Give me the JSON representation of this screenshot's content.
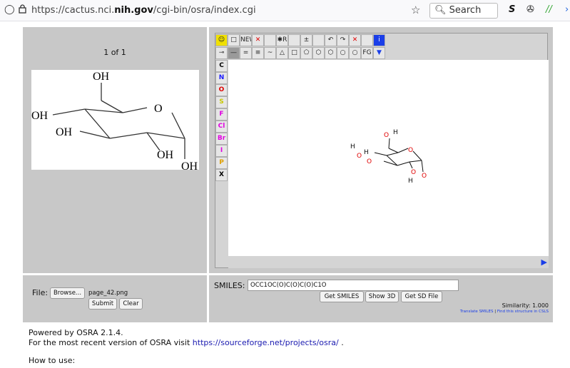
{
  "browser": {
    "url_prefix": "https://cactus.nci.",
    "url_domain": "nih.gov",
    "url_suffix": "/cgi-bin/osra/index.cgi",
    "search_placeholder": "Search"
  },
  "image_panel": {
    "page_indicator": "1 of 1"
  },
  "structure_labels": {
    "oh_top": "OH",
    "oh_left": "OH",
    "o_ring": "O",
    "oh_mid": "OH",
    "oh_bottom_a": "OH",
    "oh_bottom_b": "OH"
  },
  "editor": {
    "top_row": [
      "☺",
      "□",
      "NEW",
      "✕",
      "",
      "✱R",
      "",
      "±",
      "",
      "↶",
      "↷",
      "✕",
      "",
      "i"
    ],
    "second_row": [
      "⊸",
      "—",
      "=",
      "≡",
      "~",
      "△",
      "□",
      "⬠",
      "⬡",
      "⬡",
      "○",
      "○",
      "FG",
      "▼"
    ],
    "atoms": [
      "C",
      "N",
      "O",
      "S",
      "F",
      "Cl",
      "Br",
      "I",
      "P",
      "X"
    ],
    "atom_colors": [
      "#000000",
      "#1a1aff",
      "#e00000",
      "#c8c800",
      "#e000e0",
      "#e000e0",
      "#e000e0",
      "#e000e0",
      "#e0a000",
      "#000000"
    ],
    "canvas_labels": {
      "o1": "O",
      "h1": "H",
      "h2": "H",
      "o2": "O",
      "h3": "H",
      "o3": "O",
      "o4": "O",
      "o5": "O",
      "o6": "O",
      "h4": "H"
    }
  },
  "file_panel": {
    "label": "File:",
    "browse_label": "Browse...",
    "filename": "page_42.png",
    "submit_label": "Submit",
    "clear_label": "Clear"
  },
  "smiles_panel": {
    "label": "SMILES:",
    "value": "OCC1OC(O)C(O)C(O)C1O",
    "get_smiles_label": "Get SMILES",
    "show3d_label": "Show 3D",
    "get_sd_label": "Get SD File",
    "similarity": "Similarity: 1.000",
    "translate_link": "Translate SMILES",
    "separator": " | ",
    "csls_link": "Find this structure in CSLS"
  },
  "footer": {
    "powered": "Powered by OSRA 2.1.4.",
    "recent_prefix": "For the most recent version of OSRA visit ",
    "recent_link": "https://sourceforge.net/projects/osra/",
    "recent_suffix": " .",
    "how_to": "How to use:"
  }
}
